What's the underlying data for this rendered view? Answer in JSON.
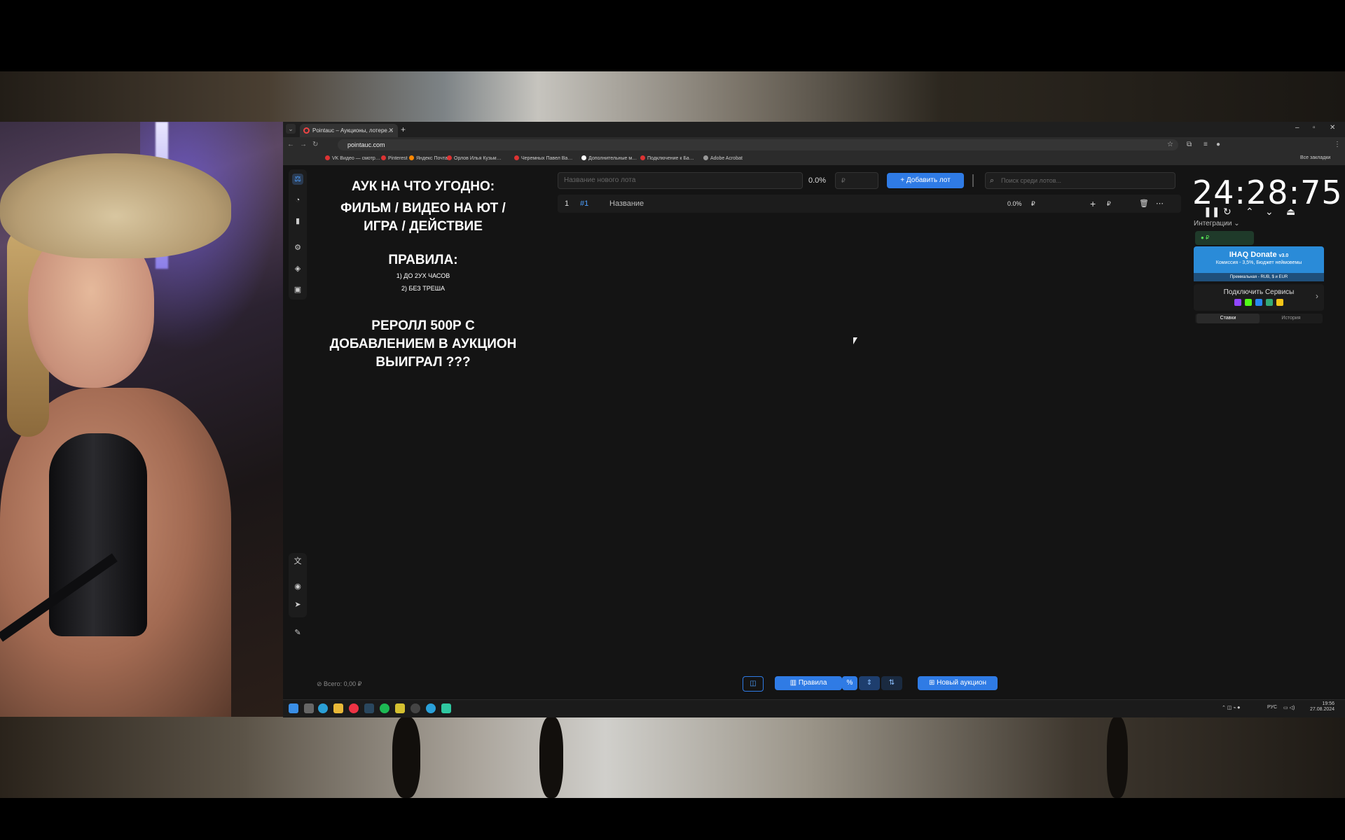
{
  "browser": {
    "tab_title": "Pointauc – Аукционы, лотере…",
    "url": "pointauc.com",
    "bookmarks": [
      "VK Видео — смотр…",
      "Pinterest",
      "Яндекс Почта",
      "Орлов Илья Кузьм…",
      "Черемных Павел Ва…",
      "Дополнительные м…",
      "Подключение к Ба…",
      "Adobe Acrobat"
    ],
    "all_bookmarks": "Все закладки"
  },
  "notes": {
    "heading": "АУК НА ЧТО УГОДНО:",
    "line2": "ФИЛЬМ / ВИДЕО НА ЮТ /",
    "line3": "ИГРА / ДЕЙСТВИЕ",
    "rules_title": "ПРАВИЛА:",
    "rule1": "1) ДО 2УХ ЧАСОВ",
    "rule2": "2) БЕЗ ТРЕША",
    "reroll1": "РЕРОЛЛ 500Р С",
    "reroll2": "ДОБАВЛЕНИЕМ В АУКЦИОН",
    "reroll3": "ВЫИГРАЛ ???"
  },
  "lot_form": {
    "name_placeholder": "Название нового лота",
    "percent": "0.0%",
    "amount_placeholder": "₽",
    "add_button": "Добавить лот",
    "search_placeholder": "Поиск среди лотов..."
  },
  "lots": [
    {
      "index": "1",
      "id": "#1",
      "name": "Название",
      "percent": "0.0%",
      "currency": "₽"
    }
  ],
  "timer": {
    "display": "24:28:75"
  },
  "integrations": {
    "label": "Интеграции",
    "pill_currency": "₽",
    "donate_title": "IHAQ Donate",
    "donate_version": "v3.0",
    "donate_sub": "Комиссия - 3,5%, Бюджет неймовемы",
    "donate_footer": "Премиальная - RUB, $ и EUR",
    "connect_label": "Подключить Сервисы",
    "tab_bids": "Ставки",
    "tab_history": "История"
  },
  "bottom": {
    "total": "Всего: 0,00 ₽",
    "rules_button": "Правила",
    "percent_symbol": "%",
    "new_auction": "Новый аукцион"
  },
  "taskbar": {
    "lang": "РУС",
    "time": "19:56",
    "date": "27.08.2024"
  },
  "colors": {
    "accent": "#2f7be5",
    "donate": "#2a8bd8",
    "bg": "#141414"
  }
}
